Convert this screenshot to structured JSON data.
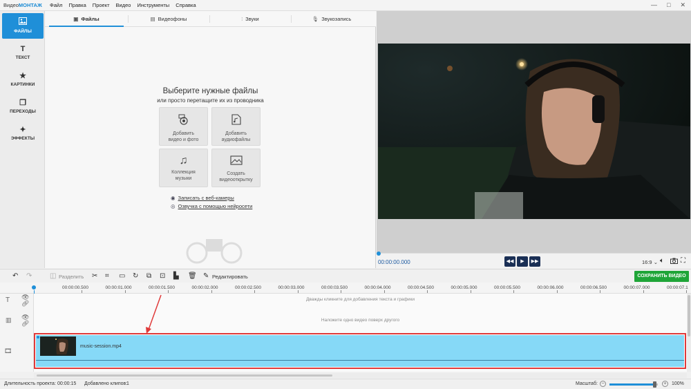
{
  "titlebar": {
    "logo_prefix": "Видео",
    "logo_brand": "МОНТАЖ",
    "menu": [
      "Файл",
      "Правка",
      "Проект",
      "Видео",
      "Инструменты",
      "Справка"
    ],
    "controls": [
      "—",
      "□",
      "✕"
    ]
  },
  "sidebar": {
    "items": [
      {
        "label": "ФАЙЛЫ",
        "icon": "image-icon",
        "active": true
      },
      {
        "label": "ТЕКСТ",
        "icon": "text-icon",
        "active": false
      },
      {
        "label": "КАРТИНКИ",
        "icon": "star-icon",
        "active": false
      },
      {
        "label": "ПЕРЕХОДЫ",
        "icon": "transition-icon",
        "active": false
      },
      {
        "label": "ЭФФЕКТЫ",
        "icon": "magic-wand-icon",
        "active": false
      }
    ]
  },
  "panel": {
    "tabs": [
      {
        "label": "Файлы",
        "icon": "image-icon",
        "active": true
      },
      {
        "label": "Видеофоны",
        "icon": "film-icon",
        "active": false
      },
      {
        "label": "Звуки",
        "icon": "sound-wave-icon",
        "active": false
      },
      {
        "label": "Звукозапись",
        "icon": "microphone-icon",
        "active": false
      }
    ],
    "title": "Выберите нужные файлы",
    "subtitle": "или просто перетащите их из проводника",
    "tiles": [
      {
        "line1": "Добавить",
        "line2": "видео и фото",
        "icon": "add-media-icon"
      },
      {
        "line1": "Добавить",
        "line2": "аудиофайлы",
        "icon": "audio-file-icon"
      },
      {
        "line1": "Коллекция",
        "line2": "музыки",
        "icon": "music-notes-icon"
      },
      {
        "line1": "Создать",
        "line2": "видеооткрытку",
        "icon": "postcard-icon"
      }
    ],
    "links": [
      {
        "label": "Записать с веб-камеры",
        "icon": "webcam-icon"
      },
      {
        "label": "Озвучка с помощью нейросети",
        "icon": "ai-voice-icon"
      }
    ]
  },
  "preview": {
    "timecode": "00:00:00.000",
    "aspect": "16:9",
    "progress": 0
  },
  "toolbar": {
    "split_label": "Разделить",
    "edit_label": "Редактировать",
    "save_label": "СОХРАНИТЬ ВИДЕО"
  },
  "timeline": {
    "ruler": [
      "00:00:00.500",
      "00:00:01.000",
      "00:00:01.500",
      "00:00:02.000",
      "00:00:02.500",
      "00:00:03.000",
      "00:00:03.500",
      "00:00:04.000",
      "00:00:04.500",
      "00:00:05.000",
      "00:00:05.500",
      "00:00:06.000",
      "00:00:06.500",
      "00:00:07.000",
      "00:00:07.1"
    ],
    "text_track_hint": "Дважды кликните для добавления текста и графики",
    "overlay_track_hint": "Наложите одно видео поверх другого",
    "clip_name": "music-session.mp4"
  },
  "status": {
    "duration_label": "Длительность проекта:",
    "duration_value": "00:00:15",
    "clips_label": "Добавлено клипов:",
    "clips_value": "1",
    "zoom_label": "Масштаб:",
    "zoom_value": "100%",
    "zoom_level": 0.93
  },
  "colors": {
    "accent": "#1f8fd8",
    "save_button": "#1fa538",
    "clip": "#86d9f7",
    "annotation": "#e03a3a"
  }
}
